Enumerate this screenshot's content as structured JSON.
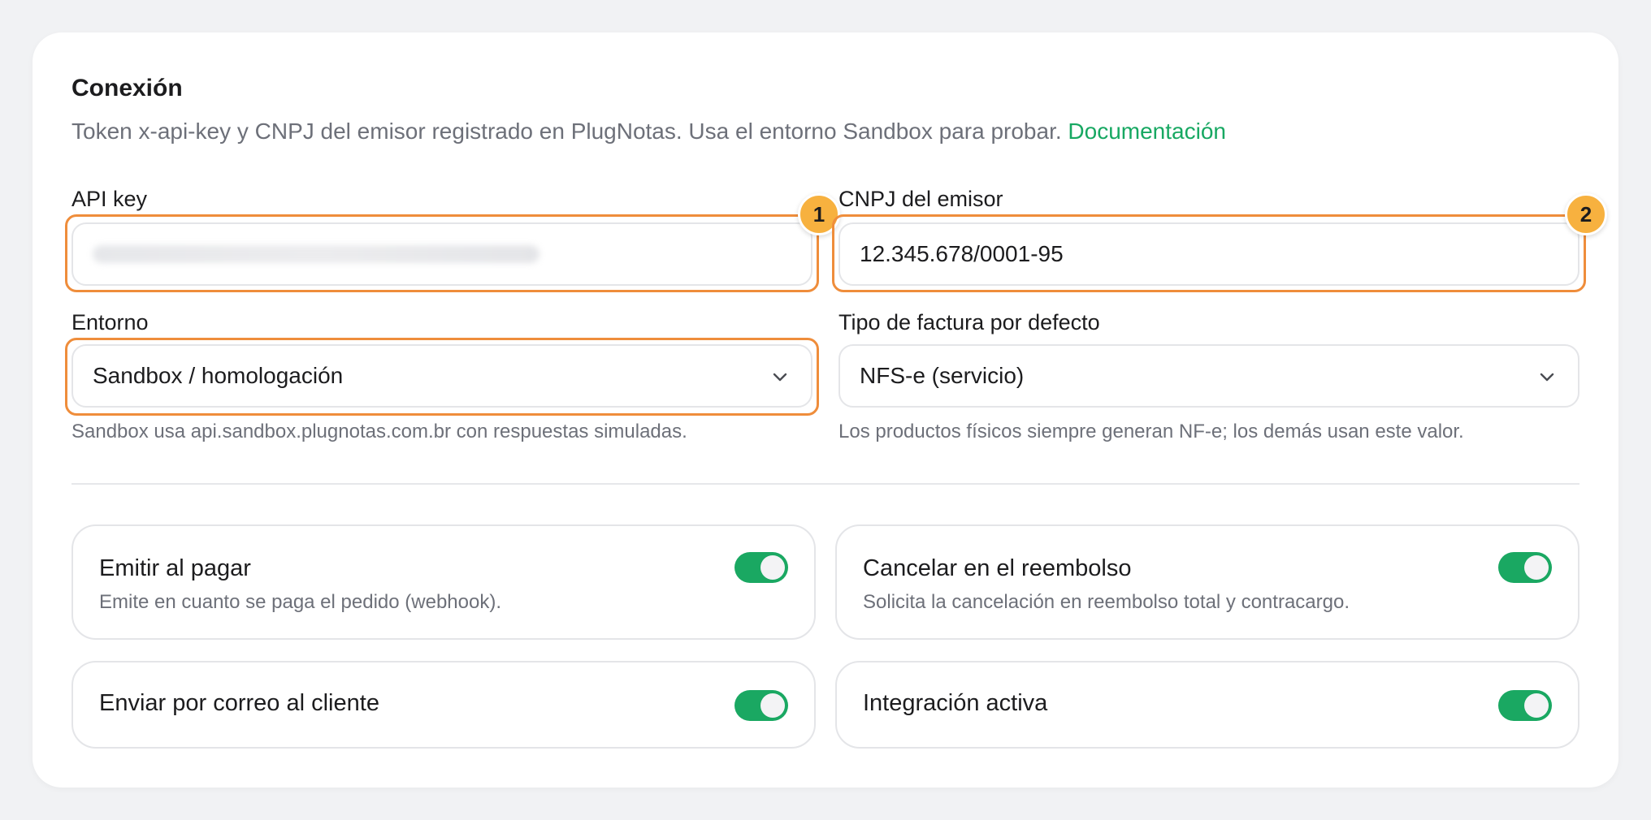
{
  "section": {
    "title": "Conexión",
    "description": "Token x-api-key y CNPJ del emisor registrado en PlugNotas. Usa el entorno Sandbox para probar.",
    "doc_link": "Documentación"
  },
  "fields": {
    "api_key": {
      "label": "API key",
      "value": ""
    },
    "cnpj": {
      "label": "CNPJ del emisor",
      "value": "12.345.678/0001-95"
    },
    "environment": {
      "label": "Entorno",
      "selected": "Sandbox / homologación",
      "hint": "Sandbox usa api.sandbox.plugnotas.com.br con respuestas simuladas."
    },
    "invoice_type": {
      "label": "Tipo de factura por defecto",
      "selected": "NFS-e (servicio)",
      "hint": "Los productos físicos siempre generan NF-e; los demás usan este valor."
    }
  },
  "badges": {
    "one": "1",
    "two": "2"
  },
  "toggles": {
    "emit_on_pay": {
      "title": "Emitir al pagar",
      "subtitle": "Emite en cuanto se paga el pedido (webhook).",
      "on": true
    },
    "cancel_refund": {
      "title": "Cancelar en el reembolso",
      "subtitle": "Solicita la cancelación en reembolso total y contracargo.",
      "on": true
    },
    "email_customer": {
      "title": "Enviar por correo al cliente",
      "on": true
    },
    "integration_active": {
      "title": "Integración activa",
      "on": true
    }
  },
  "colors": {
    "accent_green": "#17a862",
    "highlight_orange": "#ef8d3b",
    "badge_yellow": "#f7b13f"
  }
}
